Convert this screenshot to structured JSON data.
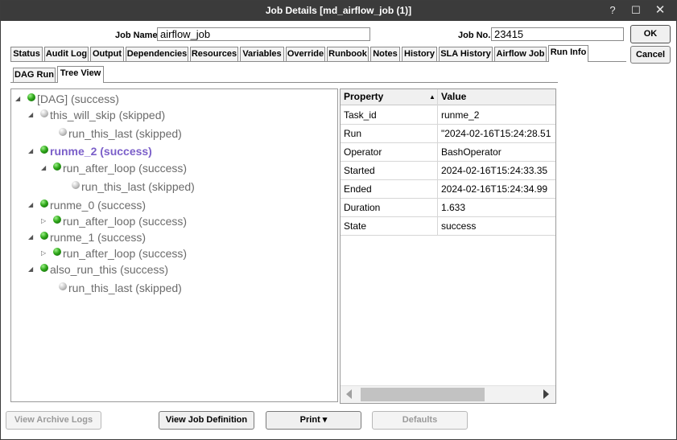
{
  "window": {
    "title": "Job Details [md_airflow_job (1)]",
    "help_icon": "?",
    "maximize_icon": "☐",
    "close_icon": "✕"
  },
  "header": {
    "job_name_label": "Job Name",
    "job_name_value": "airflow_job",
    "job_no_label": "Job No.",
    "job_no_value": "23415",
    "ok_label": "OK",
    "cancel_label": "Cancel"
  },
  "tabs": [
    {
      "label": "Status"
    },
    {
      "label": "Audit Log"
    },
    {
      "label": "Output"
    },
    {
      "label": "Dependencies"
    },
    {
      "label": "Resources"
    },
    {
      "label": "Variables"
    },
    {
      "label": "Override"
    },
    {
      "label": "Runbook"
    },
    {
      "label": "Notes"
    },
    {
      "label": "History"
    },
    {
      "label": "SLA History"
    },
    {
      "label": "Airflow Job"
    },
    {
      "label": "Run Info"
    }
  ],
  "active_tab": "Run Info",
  "subtabs": [
    {
      "label": "DAG Run"
    },
    {
      "label": "Tree View"
    }
  ],
  "active_subtab": "Tree View",
  "tree": [
    {
      "label": "[DAG] (success)",
      "status": "success",
      "depth": 0,
      "expander": "expanded"
    },
    {
      "label": "this_will_skip (skipped)",
      "status": "skipped",
      "depth": 1,
      "expander": "expanded"
    },
    {
      "label": "run_this_last (skipped)",
      "status": "skipped",
      "depth": 2,
      "expander": "none"
    },
    {
      "label": "runme_2 (success)",
      "status": "success",
      "depth": 1,
      "expander": "expanded",
      "selected": true
    },
    {
      "label": "run_after_loop (success)",
      "status": "success",
      "depth": 2,
      "expander": "expanded"
    },
    {
      "label": "run_this_last (skipped)",
      "status": "skipped",
      "depth": 3,
      "expander": "none"
    },
    {
      "label": "runme_0 (success)",
      "status": "success",
      "depth": 1,
      "expander": "expanded"
    },
    {
      "label": "run_after_loop (success)",
      "status": "success",
      "depth": 2,
      "expander": "collapsed"
    },
    {
      "label": "runme_1 (success)",
      "status": "success",
      "depth": 1,
      "expander": "expanded"
    },
    {
      "label": "run_after_loop (success)",
      "status": "success",
      "depth": 2,
      "expander": "collapsed"
    },
    {
      "label": "also_run_this (success)",
      "status": "success",
      "depth": 1,
      "expander": "expanded"
    },
    {
      "label": "run_this_last (skipped)",
      "status": "skipped",
      "depth": 2,
      "expander": "none"
    }
  ],
  "properties": {
    "columns": [
      "Property",
      "Value"
    ],
    "sort_indicator": "▲",
    "rows": [
      {
        "property": "Task_id",
        "value": "runme_2"
      },
      {
        "property": "Run",
        "value": "\"2024-02-16T15:24:28.51"
      },
      {
        "property": "Operator",
        "value": "BashOperator"
      },
      {
        "property": "Started",
        "value": "2024-02-16T15:24:33.35"
      },
      {
        "property": "Ended",
        "value": "2024-02-16T15:24:34.99"
      },
      {
        "property": "Duration",
        "value": "1.633"
      },
      {
        "property": "State",
        "value": "success"
      }
    ]
  },
  "footer": {
    "view_archive_logs": "View Archive Logs",
    "view_job_definition": "View Job Definition",
    "print": "Print ▾",
    "defaults": "Defaults"
  },
  "colors": {
    "titlebar": "#3b3b3b",
    "selected_node": "#7b5fc9",
    "success_dot": "#2fa81a",
    "skipped_dot": "#c8c8c8"
  }
}
